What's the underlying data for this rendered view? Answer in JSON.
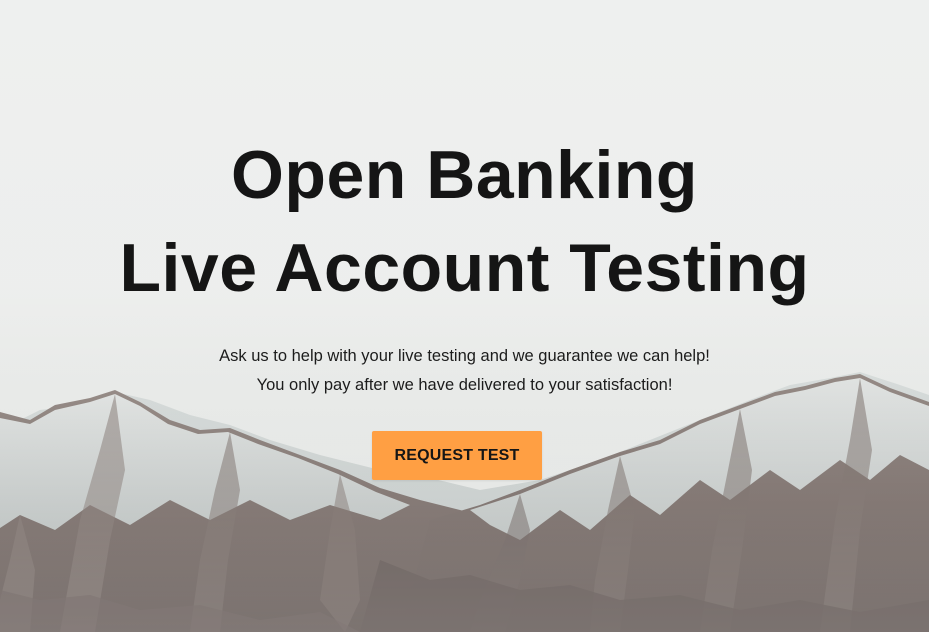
{
  "hero": {
    "title_line_1": "Open Banking",
    "title_line_2": "Live Account Testing",
    "subtitle_line_1": "Ask us to help with your live testing and we guarantee we can help!",
    "subtitle_line_2": "You only pay after we have delivered to your satisfaction!",
    "cta_label": "REQUEST TEST",
    "background": "snowy-mountains-image"
  },
  "colors": {
    "cta_background": "#ff9f43",
    "text": "#151515",
    "sky": "#eceeec"
  }
}
